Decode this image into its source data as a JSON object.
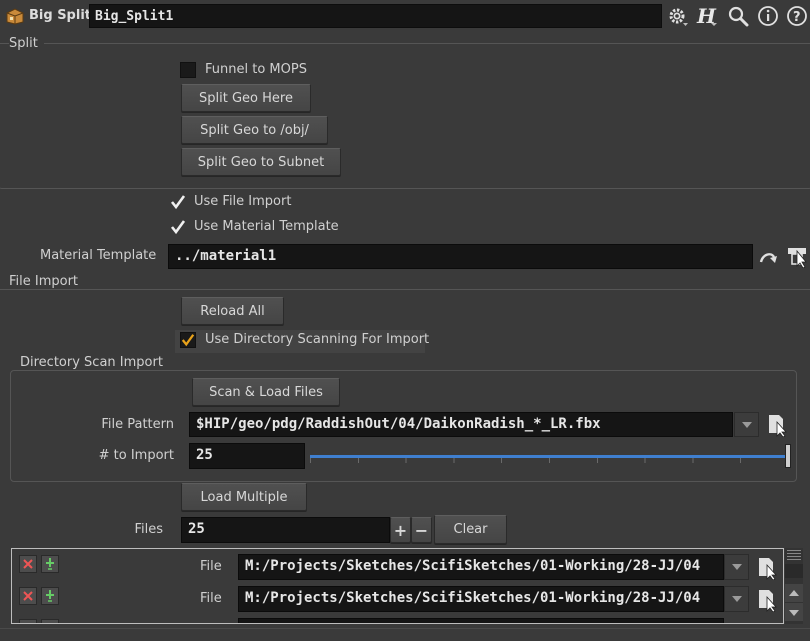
{
  "header": {
    "node_type": "Big Split",
    "node_name": "Big_Split1",
    "icons": [
      "box-node-icon",
      "gear-icon",
      "houdini-help-icon",
      "search-icon",
      "info-icon",
      "help-icon"
    ]
  },
  "split": {
    "folder_title": "Split",
    "funnel_label": "Funnel to MOPS",
    "funnel_checked": false,
    "btn_split_here": "Split Geo Here",
    "btn_split_obj": "Split Geo to /obj/",
    "btn_split_subnet": "Split Geo to Subnet"
  },
  "options": {
    "use_file_import": "Use File Import",
    "use_file_import_checked": true,
    "use_material_template": "Use Material Template",
    "use_material_template_checked": true,
    "material_template_label": "Material Template",
    "material_template_value": "../material1"
  },
  "file_import": {
    "folder_title": "File Import",
    "reload_all": "Reload All",
    "use_dir_scan": "Use Directory Scanning For Import",
    "use_dir_scan_checked": true
  },
  "dir_scan": {
    "folder_title": "Directory Scan Import",
    "scan_btn": "Scan & Load Files",
    "pattern_label": "File Pattern",
    "pattern_value": "$HIP/geo/pdg/RaddishOut/04/DaikonRadish_*_LR.fbx",
    "num_label": "# to Import",
    "num_value": "25",
    "slider_fraction": 1.0
  },
  "multi": {
    "load_multiple": "Load Multiple",
    "files_label": "Files",
    "files_value": "25",
    "plus": "+",
    "minus": "−",
    "clear": "Clear",
    "rows": [
      {
        "label": "File",
        "value": "M:/Projects/Sketches/ScifiSketches/01-Working/28-JJ/04"
      },
      {
        "label": "File",
        "value": "M:/Projects/Sketches/ScifiSketches/01-Working/28-JJ/04"
      }
    ]
  },
  "colors": {
    "background": "#3a3a3a",
    "field": "#151515",
    "accent_check": "#e8a21a",
    "slider": "#3f7fcf"
  }
}
